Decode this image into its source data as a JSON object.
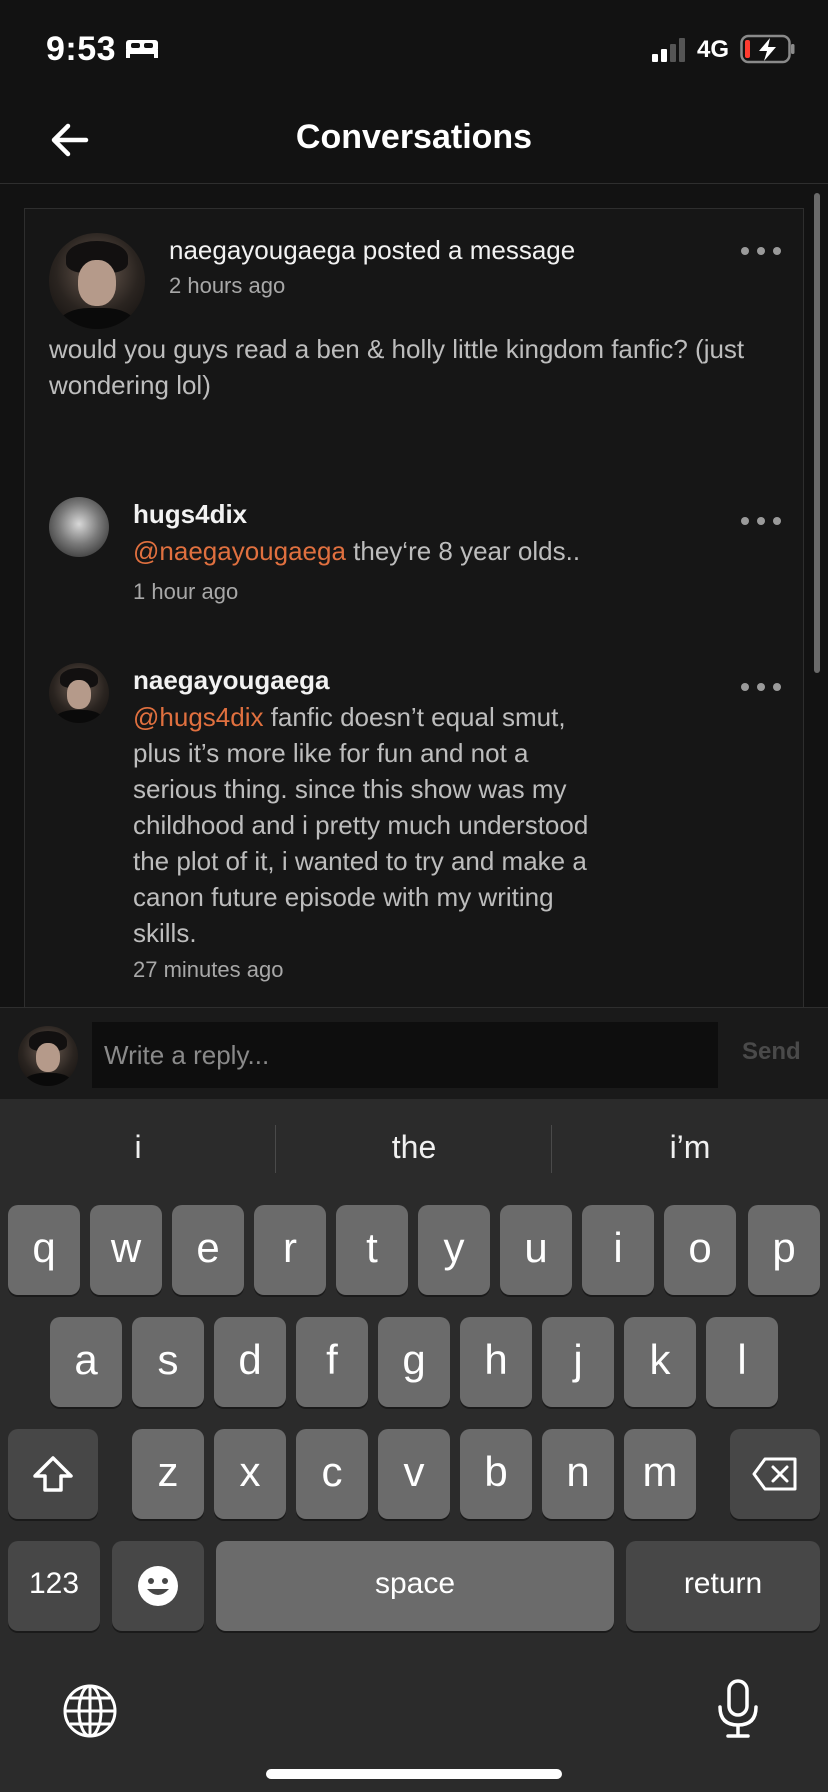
{
  "status_bar": {
    "time": "9:53",
    "network": "4G",
    "icons": [
      "bed-icon",
      "signal-icon",
      "battery-charging-icon"
    ]
  },
  "header": {
    "title": "Conversations",
    "back_icon": "back-arrow-icon"
  },
  "post": {
    "author_line": "naegayougaega posted a message",
    "time": "2 hours ago",
    "body": "would you guys read a ben & holly little kingdom fanfic? (just wondering lol)"
  },
  "comments": [
    {
      "author": "hugs4dix",
      "mention": "@naegayougaega",
      "text": " they‘re 8 year olds..",
      "time": "1 hour ago"
    },
    {
      "author": "naegayougaega",
      "mention": "@hugs4dix",
      "text": " fanfic doesn’t equal smut, plus it’s more like for fun and not a serious thing. since this show was my childhood and i pretty much understood the plot of it, i wanted to try and make a canon future episode with my writing skills.",
      "time": "27 minutes ago"
    }
  ],
  "reply": {
    "placeholder": "Write a reply...",
    "send_label": "Send"
  },
  "keyboard": {
    "suggestions": [
      "i",
      "the",
      "i’m"
    ],
    "row1": [
      "q",
      "w",
      "e",
      "r",
      "t",
      "y",
      "u",
      "i",
      "o",
      "p"
    ],
    "row2": [
      "a",
      "s",
      "d",
      "f",
      "g",
      "h",
      "j",
      "k",
      "l"
    ],
    "row3": [
      "z",
      "x",
      "c",
      "v",
      "b",
      "n",
      "m"
    ],
    "numbers_label": "123",
    "space_label": "space",
    "return_label": "return"
  },
  "colors": {
    "background": "#121212",
    "mention": "#e0703f",
    "keyboard": "#2b2b2b",
    "key": "#6b6b6b"
  }
}
